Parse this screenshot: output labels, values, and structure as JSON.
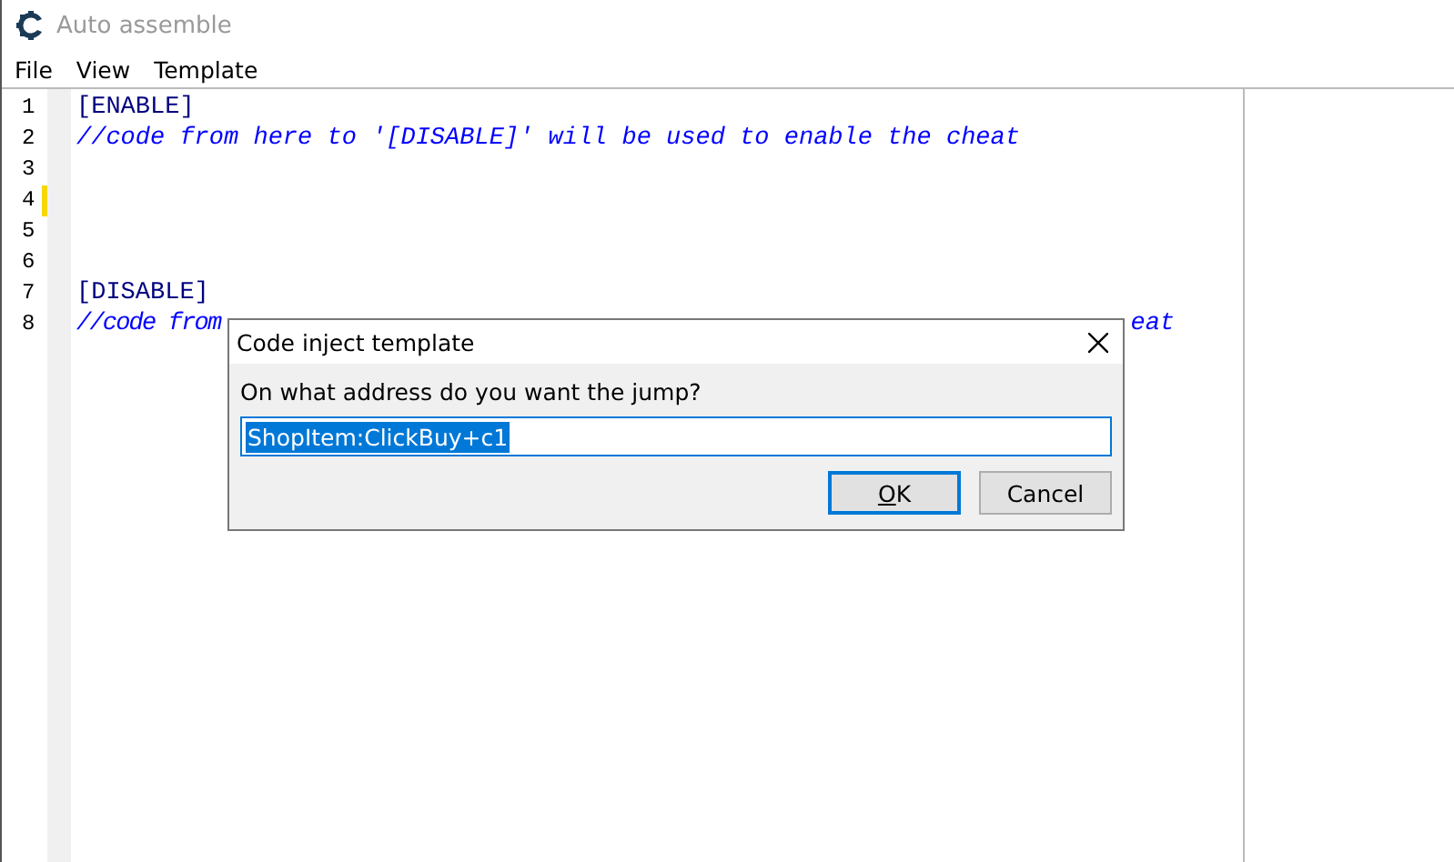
{
  "window": {
    "title": "Auto assemble"
  },
  "menu": [
    {
      "label": "File"
    },
    {
      "label": "View"
    },
    {
      "label": "Template"
    }
  ],
  "editor": {
    "lines": [
      {
        "number": "1",
        "kind": "label",
        "marked": false,
        "segments": [
          "[ENABLE]"
        ]
      },
      {
        "number": "2",
        "kind": "comment",
        "marked": false,
        "segments": [
          "//code from here to '[DISABLE]' will be used to enable the cheat"
        ]
      },
      {
        "number": "3",
        "kind": "label",
        "marked": false
      },
      {
        "number": "4",
        "kind": "label",
        "marked": true
      },
      {
        "number": "5",
        "kind": "label",
        "marked": false
      },
      {
        "number": "6",
        "kind": "label",
        "marked": false
      },
      {
        "number": "7",
        "kind": "label",
        "marked": false,
        "segments": [
          "[DISABLE]"
        ]
      },
      {
        "number": "8",
        "kind": "comment",
        "marked": false,
        "segments": [
          "//code from",
          "eat"
        ]
      }
    ]
  },
  "dialog": {
    "title": "Code inject template",
    "prompt": "On what address do you want the jump?",
    "value": "ShopItem:ClickBuy+c1",
    "value_selected": true,
    "buttons": [
      {
        "label": "OK",
        "kind": "ok",
        "default": true
      },
      {
        "label": "Cancel",
        "kind": "cancel",
        "default": false
      }
    ]
  }
}
